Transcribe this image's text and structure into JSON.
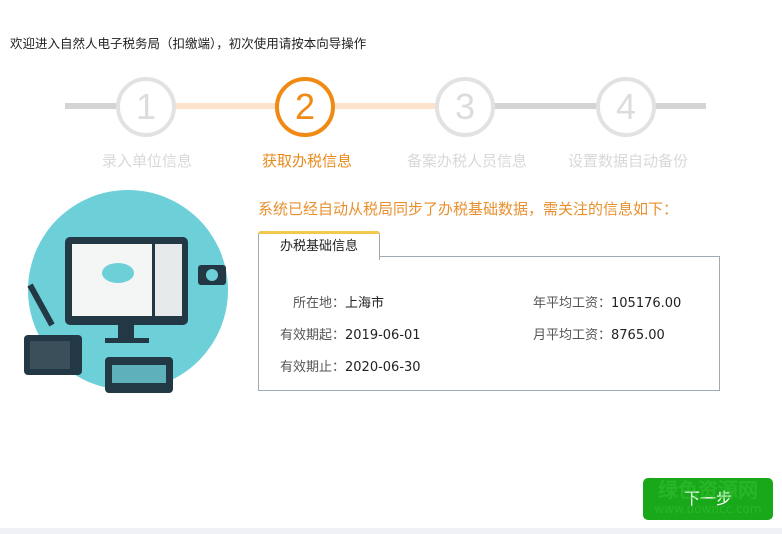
{
  "header": {
    "welcome": "欢迎进入自然人电子税务局（扣缴端），初次使用请按本向导操作"
  },
  "steps": [
    {
      "number": "1",
      "label": "录入单位信息",
      "state": "done"
    },
    {
      "number": "2",
      "label": "获取办税信息",
      "state": "active"
    },
    {
      "number": "3",
      "label": "备案办税人员信息",
      "state": "pending"
    },
    {
      "number": "4",
      "label": "设置数据自动备份",
      "state": "pending"
    }
  ],
  "main": {
    "notice": "系统已经自动从税局同步了办税基础数据，需关注的信息如下：",
    "tab_label": "办税基础信息",
    "fields": [
      {
        "key": "所在地：",
        "value": "上海市"
      },
      {
        "key": "有效期起：",
        "value": "2019-06-01"
      },
      {
        "key": "有效期止：",
        "value": "2020-06-30"
      },
      {
        "key": "年平均工资：",
        "value": "105176.00"
      },
      {
        "key": "月平均工资：",
        "value": "8765.00"
      }
    ]
  },
  "footer": {
    "next_label": "下一步"
  },
  "watermark": {
    "text": "绿色资源网",
    "url": "www.downcc.com"
  },
  "colors": {
    "accent": "#f08a14",
    "button": "#19a819",
    "illustration_bg": "#6dd0d8"
  }
}
